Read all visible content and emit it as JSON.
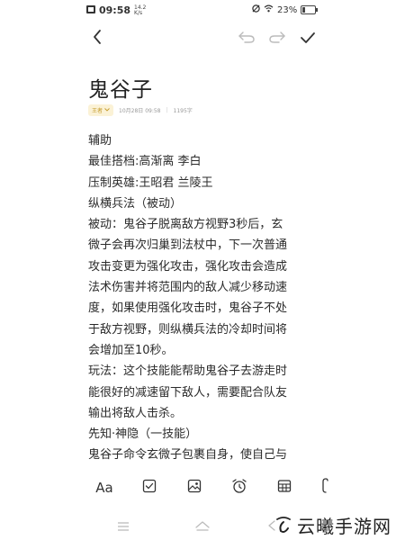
{
  "status_bar": {
    "time": "09:58",
    "net_speed_value": "14.2",
    "net_speed_unit": "K/s",
    "battery": "23%",
    "battery_level": 0.23
  },
  "toolbar": {
    "back_icon": "chevron-left-icon",
    "undo_icon": "undo-icon",
    "redo_icon": "redo-icon",
    "done_icon": "check-icon"
  },
  "note": {
    "title": "鬼谷子",
    "folder": "王者",
    "datetime": "10月28日 09:58",
    "char_count": "1195字",
    "lines": [
      "辅助",
      "最佳搭档:高渐离 李白",
      "压制英雄:王昭君 兰陵王",
      "纵横兵法（被动）",
      "被动：鬼谷子脱离敌方视野3秒后，玄",
      "微子会再次归巢到法杖中，下一次普通",
      "攻击变更为强化攻击，强化攻击会造成",
      "法术伤害并将范围内的敌人减少移动速",
      "度，如果使用强化攻击时，鬼谷子不处",
      "于敌方视野，则纵横兵法的冷却时间将",
      "会增加至10秒。",
      "玩法：这个技能能帮助鬼谷子去游走时",
      "能很好的减速留下敌人，需要配合队友",
      "输出将敌人击杀。",
      "先知·神隐（一技能）",
      "鬼谷子命令玄微子包裹自身，使自己与"
    ]
  },
  "format_bar": {
    "text_style_label": "Aa",
    "icons": [
      "checkbox-icon",
      "image-icon",
      "alarm-icon",
      "table-icon",
      "attachment-icon"
    ]
  },
  "nav_bar": {
    "icons": [
      "menu-icon",
      "home-icon",
      "back-icon"
    ]
  },
  "watermark": {
    "text": "云曦手游网"
  }
}
